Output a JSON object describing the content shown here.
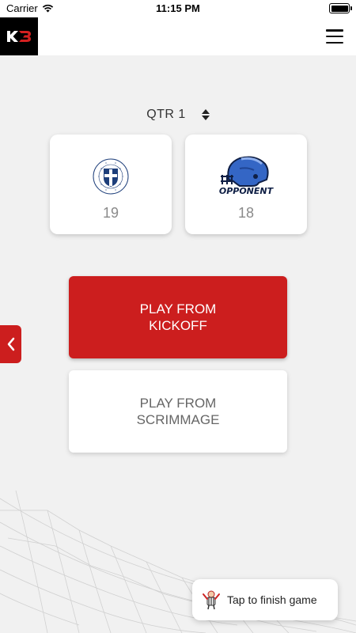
{
  "status_bar": {
    "carrier": "Carrier",
    "time": "11:15 PM"
  },
  "header": {
    "logo_icon": "kb-logo-icon",
    "menu_icon": "hamburger-menu-icon"
  },
  "quarter": {
    "label": "QTR 1"
  },
  "teams": {
    "home": {
      "score": "19",
      "logo_icon": "school-crest-logo"
    },
    "away": {
      "score": "18",
      "logo_icon": "football-helmet-logo",
      "logo_text": "OPPONENT"
    }
  },
  "actions": {
    "kickoff_label": "PLAY FROM\nKICKOFF",
    "scrimmage_label": "PLAY FROM\nSCRIMMAGE"
  },
  "finish": {
    "label": "Tap to finish game",
    "icon": "referee-icon"
  },
  "colors": {
    "accent": "#cc1e1e",
    "background": "#f1f1f1",
    "card": "#ffffff",
    "score_text": "#8a8a8a"
  }
}
